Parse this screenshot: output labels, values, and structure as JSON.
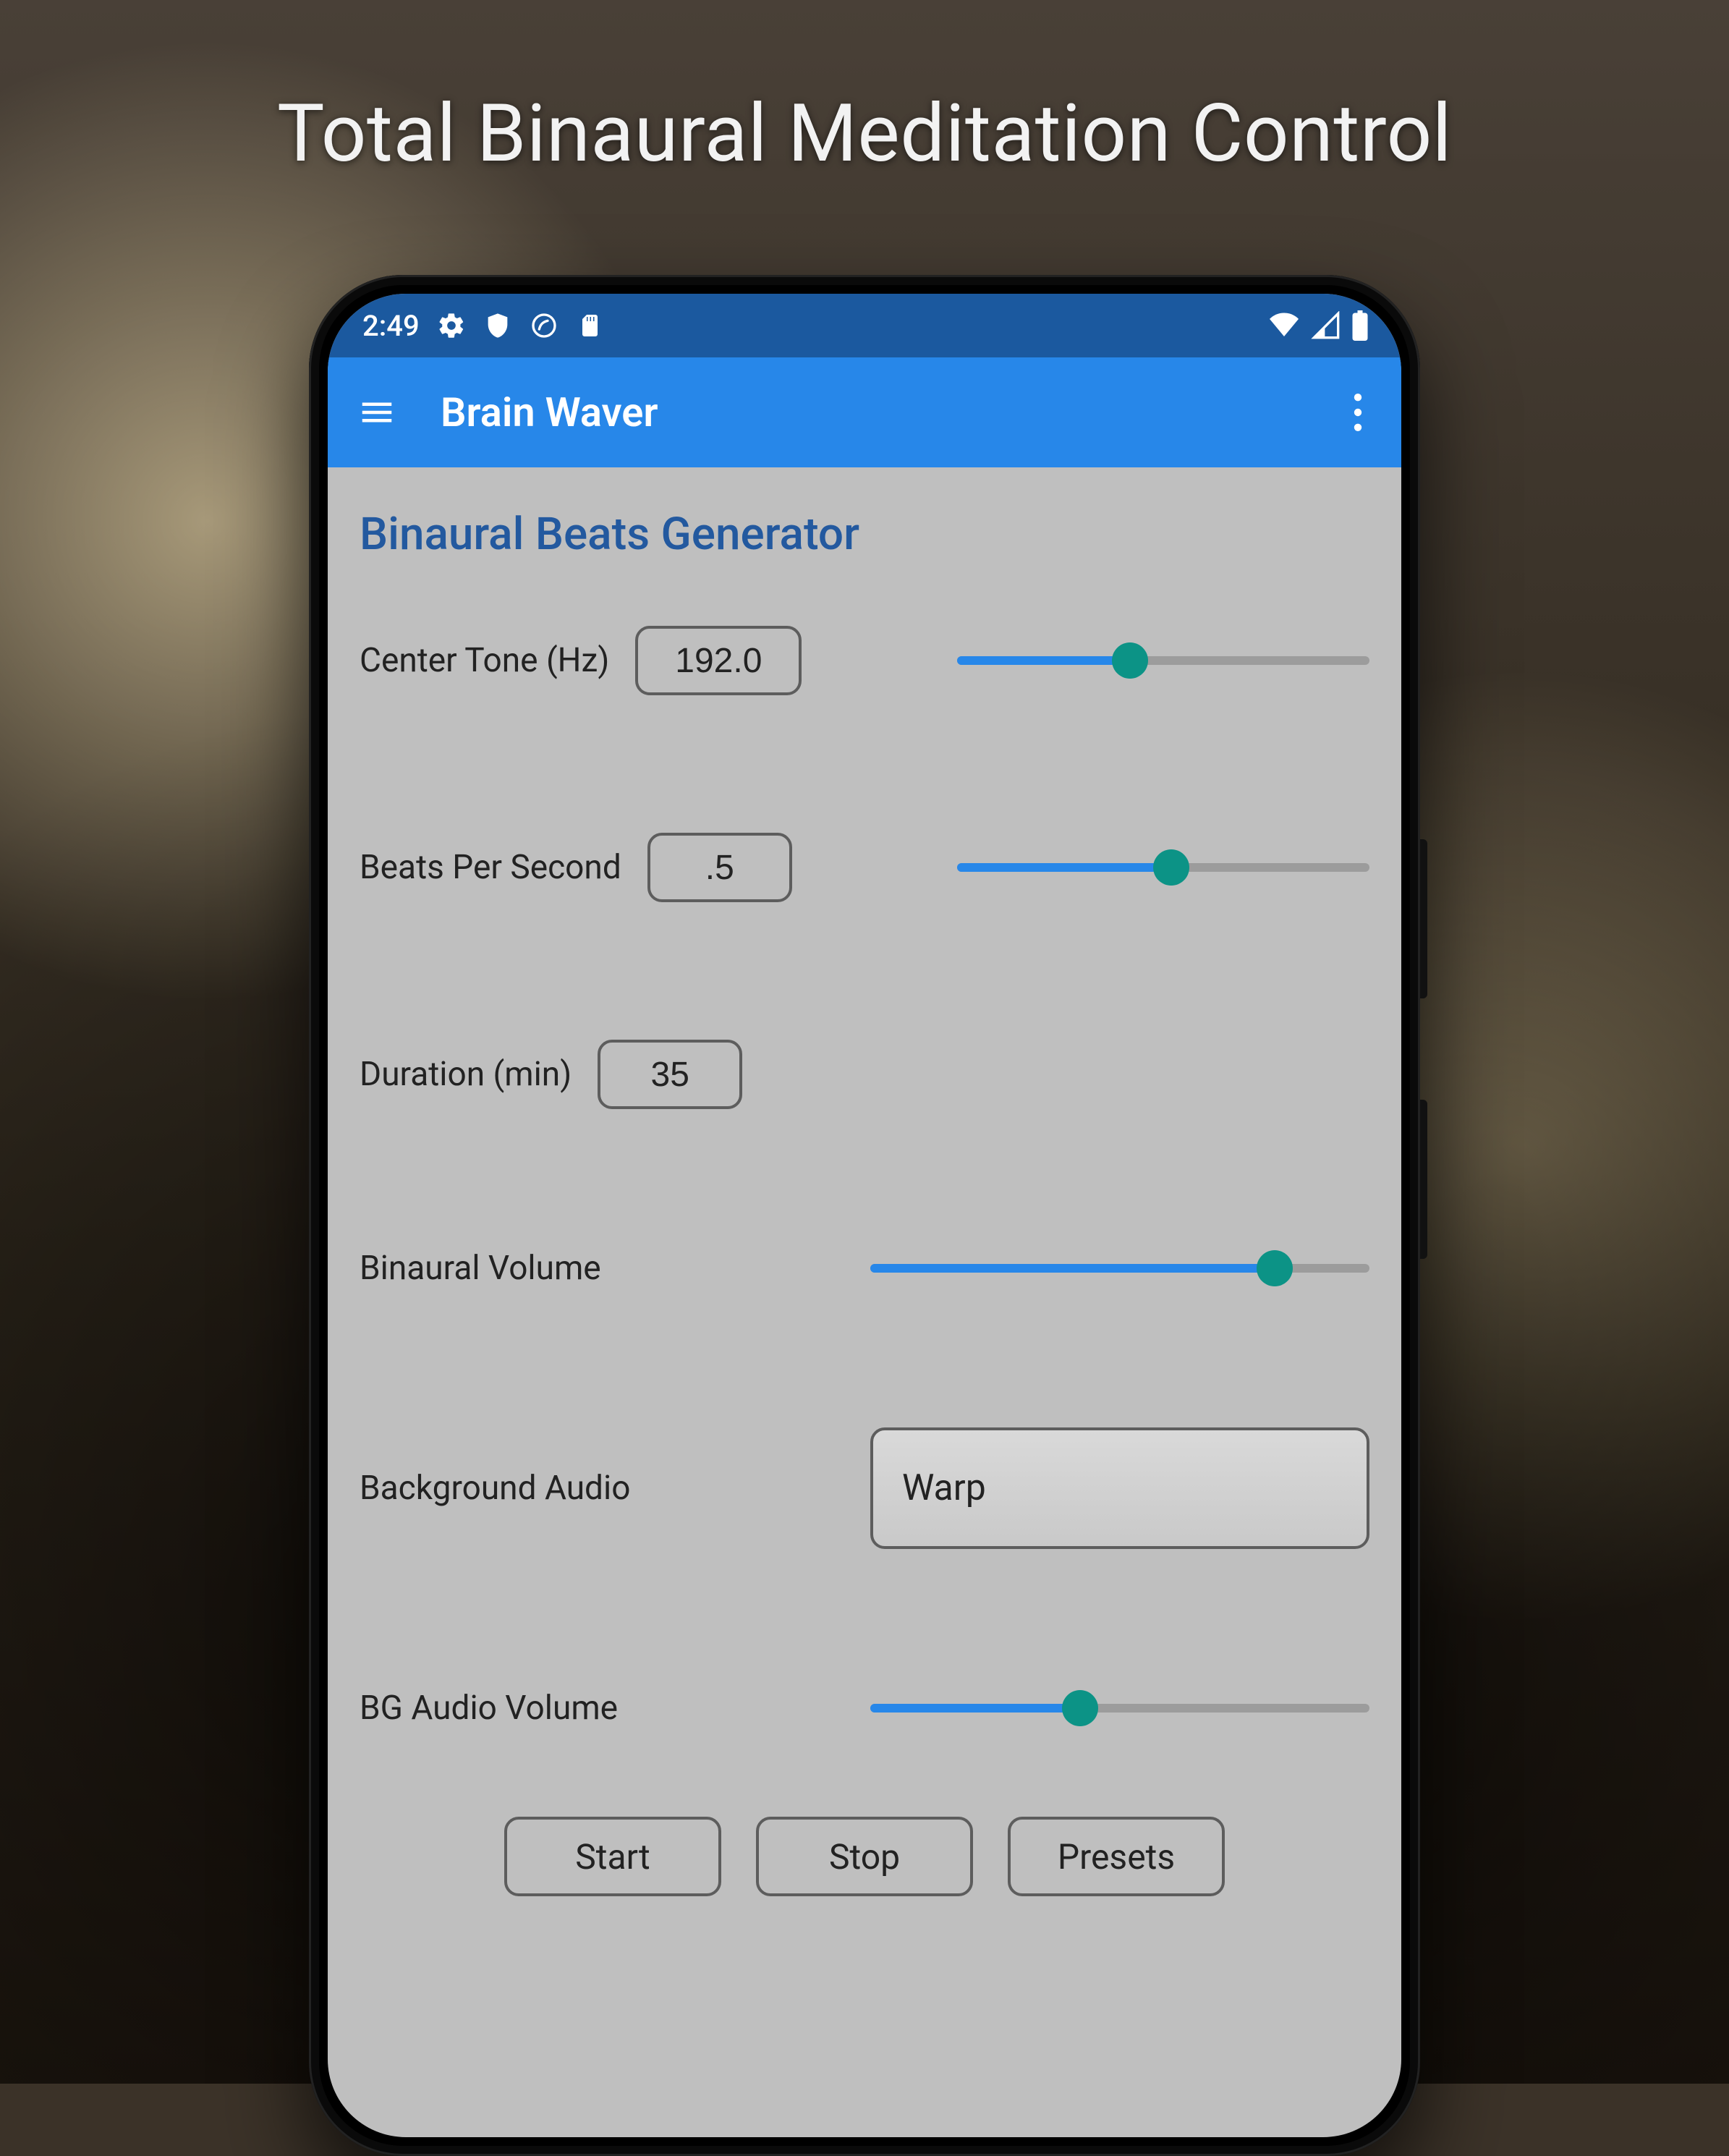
{
  "promo": {
    "title": "Total Binaural Meditation Control"
  },
  "status_bar": {
    "time": "2:49"
  },
  "app_bar": {
    "title": "Brain Waver"
  },
  "section": {
    "title": "Binaural Beats Generator"
  },
  "controls": {
    "center_tone": {
      "label": "Center Tone (Hz)",
      "value": "192.0",
      "slider_pct": 42
    },
    "bps": {
      "label": "Beats Per Second",
      "value": ".5",
      "slider_pct": 52
    },
    "duration": {
      "label": "Duration (min)",
      "value": "35"
    },
    "bin_vol": {
      "label": "Binaural Volume",
      "slider_pct": 81
    },
    "bg_audio": {
      "label": "Background Audio",
      "value": "Warp"
    },
    "bg_vol": {
      "label": "BG Audio Volume",
      "slider_pct": 42
    }
  },
  "buttons": {
    "start": "Start",
    "stop": "Stop",
    "presets": "Presets"
  }
}
